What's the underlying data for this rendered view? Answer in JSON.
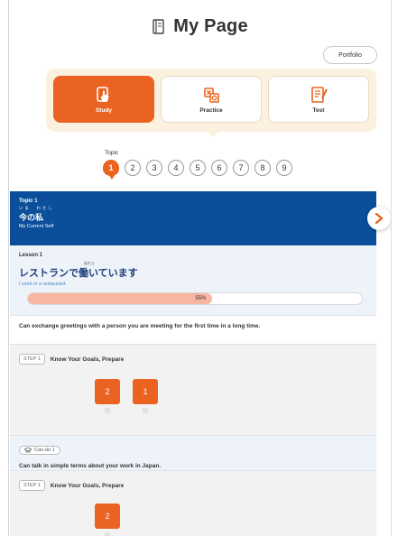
{
  "header": {
    "title": "My Page",
    "icon": "book-icon",
    "portfolio_label": "Portfolio"
  },
  "modes": [
    {
      "label": "Study",
      "icon": "study-icon",
      "active": true
    },
    {
      "label": "Practice",
      "icon": "practice-icon",
      "active": false
    },
    {
      "label": "Test",
      "icon": "test-icon",
      "active": false
    }
  ],
  "topics": {
    "label": "Topic",
    "numbers": [
      "1",
      "2",
      "3",
      "4",
      "5",
      "6",
      "7",
      "8",
      "9"
    ],
    "selected": "1"
  },
  "topic_card": {
    "topic_no": "Topic 1",
    "ruby": "いま　わたし",
    "title_jp": "今の私",
    "title_en": "My Current Self"
  },
  "lesson": {
    "label": "Lesson 1",
    "ruby": "はたら",
    "title_jp": "レストランで働いています",
    "title_en": "I work in a restaurant.",
    "progress_percent": 55,
    "progress_text": "55%"
  },
  "goal": {
    "text": "Can exchange greetings with a person you are meeting for the first time in a long time."
  },
  "step1": {
    "tag": "STEP 1",
    "title": "Know Your Goals, Prepare",
    "items": [
      "2",
      "1"
    ]
  },
  "cando": {
    "chip": "Can-do 1",
    "text": "Can talk in simple terms about your work in Japan."
  },
  "step2": {
    "tag": "STEP 1",
    "title": "Know Your Goals, Prepare",
    "items": [
      "2"
    ]
  },
  "colors": {
    "accent": "#ea6321",
    "banner": "#0b4f9a",
    "panel": "#fcf0df",
    "progress": "#f8b5a0"
  }
}
